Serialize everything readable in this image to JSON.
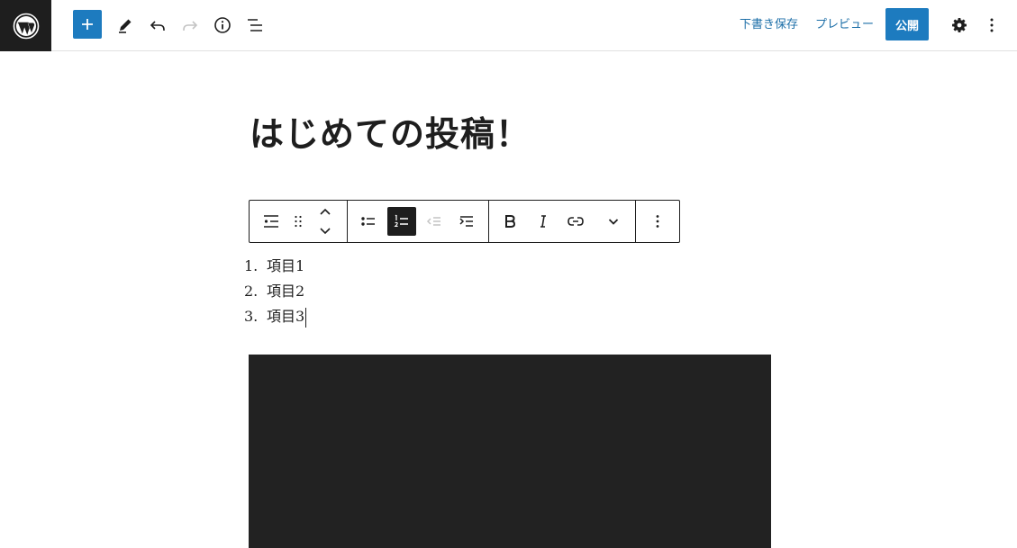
{
  "header": {
    "logo_icon": "wordpress-logo-icon",
    "add_block_icon": "plus-icon",
    "tools_icon": "pencil-icon",
    "undo_icon": "undo-icon",
    "redo_icon": "redo-icon",
    "info_icon": "info-icon",
    "outline_icon": "list-view-icon",
    "save_draft_label": "下書き保存",
    "preview_label": "プレビュー",
    "publish_label": "公開",
    "settings_icon": "gear-icon",
    "more_icon": "vertical-ellipsis-icon"
  },
  "post": {
    "title": "はじめての投稿！"
  },
  "block_toolbar": {
    "block_type_icon": "list-block-icon",
    "drag_icon": "drag-handle-icon",
    "move_icon": "move-up-down-icon",
    "unordered_icon": "unordered-list-icon",
    "ordered_icon": "ordered-list-icon",
    "outdent_icon": "outdent-icon",
    "indent_icon": "indent-icon",
    "bold_icon": "bold-icon",
    "italic_icon": "italic-icon",
    "link_icon": "link-icon",
    "more_formats_icon": "chevron-down-icon",
    "options_icon": "vertical-ellipsis-icon"
  },
  "list": {
    "items": [
      {
        "number": "1.",
        "text": "項目1"
      },
      {
        "number": "2.",
        "text": "項目2"
      },
      {
        "number": "3.",
        "text": "項目3"
      }
    ]
  },
  "colors": {
    "accent": "#1d7bbf",
    "link": "#1d6fa8",
    "dark": "#1e1e1e",
    "media_background": "#222222"
  }
}
